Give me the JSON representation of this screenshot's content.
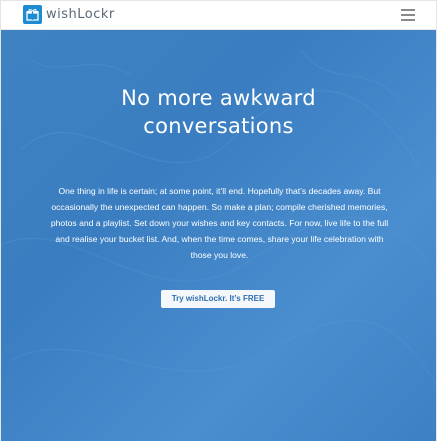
{
  "header": {
    "brand": "wishLockr",
    "logo_icon": "gift-icon",
    "menu_icon": "hamburger-menu-icon"
  },
  "hero": {
    "title_line1": "No more awkward",
    "title_line2": "conversations",
    "body": "One thing in life is certain; at some point, it’ll end. Hopefully that’s decades away. But occasionally the unexpected can happen. So make a plan; compile cherished memories, photos and a playlist. Set down your wishes and key contacts. For now, live life to the full and realise your bucket list. And, when the time comes, share your life celebration with those you love.",
    "cta_label": "Try wishLockr. It’s FREE"
  },
  "colors": {
    "brand_blue": "#1d8bd1",
    "hero_blue": "#3e82c2",
    "cta_text": "#2f6fb0"
  }
}
